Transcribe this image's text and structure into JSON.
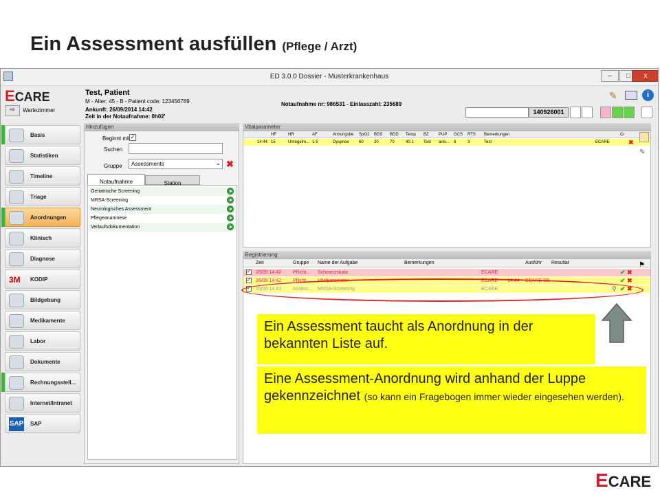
{
  "slide": {
    "title_main": "Ein Assessment ausfüllen",
    "title_sub": "(Pflege / Arzt)"
  },
  "window": {
    "title": "ED 3.0.0 Dossier - Musterkrankenhaus",
    "btn_min": "–",
    "btn_max": "□",
    "btn_close": "x"
  },
  "logo": {
    "e": "E",
    "care": "CARE"
  },
  "wartezimmer": "Wartezimmer",
  "patient": {
    "name": "Test, Patient",
    "info": "M - Alter: 45 - B - Patient code: 123456789",
    "arrival": "Ankunft: 26/09/2014 14:42",
    "time_since": "Zeit in der Notaufnahme: 0h02'",
    "numbers": "Notaufnahme nr: 986531 - Einlasszahl: 235689",
    "code": "140926001"
  },
  "sidebar": {
    "items": [
      {
        "label": "Basis",
        "icon": "gauge-icon"
      },
      {
        "label": "Statistiken",
        "icon": "stats-icon"
      },
      {
        "label": "Timeline",
        "icon": "timeline-icon"
      },
      {
        "label": "Triage",
        "icon": "triage-icon"
      },
      {
        "label": "Anordnungen",
        "icon": "clock-icon"
      },
      {
        "label": "Klinisch",
        "icon": "clipboard-icon"
      },
      {
        "label": "Diagnose",
        "icon": "stethoscope-icon"
      },
      {
        "label": "KODIP",
        "icon": "3m-logo-icon",
        "prefix": "3M"
      },
      {
        "label": "Bildgebung",
        "icon": "radiation-icon"
      },
      {
        "label": "Medikamente",
        "icon": "pills-icon"
      },
      {
        "label": "Labor",
        "icon": "test-tube-icon"
      },
      {
        "label": "Dokumente",
        "icon": "document-icon"
      },
      {
        "label": "Rechnungsstell...",
        "icon": "billing-icon"
      },
      {
        "label": "Internet/Intranet",
        "icon": "globe-icon"
      },
      {
        "label": "SAP",
        "icon": "sap-logo-icon",
        "prefix": "SAP"
      }
    ]
  },
  "hinzufuegen": {
    "header": "Hinzufügen",
    "beginnt_label": "Beginnt mit",
    "suchen_label": "Suchen",
    "suchen_value": "",
    "gruppe_label": "Gruppe",
    "gruppe_value": "Assessments",
    "tabs": [
      "Notaufnahme",
      "Station"
    ],
    "items": [
      "Geriatrische Screening",
      "MRSA-Screening",
      "Neurologisches Assessment",
      "Pflegeanamnese",
      "Verlaufsdokumentation"
    ]
  },
  "vitals": {
    "header": "Vitalparameter",
    "columns": [
      "HF",
      "HR",
      "AF",
      "Atmungsbe",
      "SpO2",
      "BDS",
      "BDD",
      "Temp",
      "BZ",
      "PUP",
      "GCS",
      "RTS",
      "Bemerkungen",
      "Cr"
    ],
    "row": [
      "14:44",
      "15",
      "Unregelm...",
      "1-5",
      "Dyspnoe",
      "60",
      "20",
      "70",
      "40.1",
      "Test",
      "anis...",
      "6",
      "3",
      "Test",
      "ECARE"
    ]
  },
  "registrierung": {
    "header": "Registrierung",
    "columns": [
      "Zeit",
      "Gruppe",
      "Name der Aufgabe",
      "Bemerkungen",
      "Ausführ",
      "Resultat"
    ],
    "rows": [
      {
        "zeit": "26/09 14:42",
        "gruppe": "Pflicht...",
        "name": "Schmerzskala",
        "bem": "ECARE",
        "ausf": "",
        "res": ""
      },
      {
        "zeit": "26/09 14:42",
        "gruppe": "Pflicht...",
        "name": "Vitalparameter",
        "bem": "ECARE",
        "ausf": "14:44",
        "res": "ECARE OK"
      },
      {
        "zeit": "26/09 14:43",
        "gruppe": "Assess...",
        "name": "MRSA-Screening",
        "bem": "ECARE",
        "ausf": "",
        "res": ""
      }
    ]
  },
  "callouts": {
    "box1": "Ein Assessment taucht als Anordnung in der bekannten Liste auf.",
    "box2_main": "Eine Assessment-Anordnung wird anhand der Luppe gekennzeichnet",
    "box2_small": "(so kann ein Fragebogen immer wieder eingesehen werden)."
  },
  "colors": {
    "accent_red": "#c9202c",
    "highlight_yellow": "#ffff14",
    "ellipse_red": "#e22020",
    "arrow_gray": "#7d8a86"
  }
}
